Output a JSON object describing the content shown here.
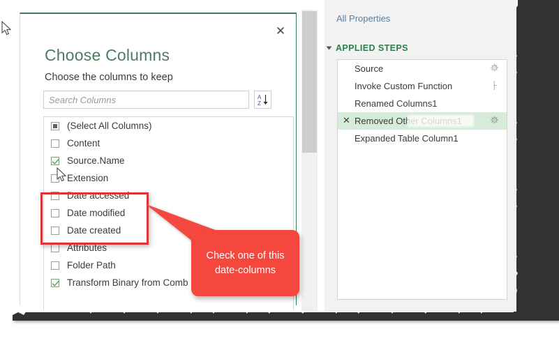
{
  "dialog": {
    "title": "Choose Columns",
    "subtitle": "Choose the columns to keep",
    "close_label": "✕",
    "search": {
      "placeholder": "Search Columns",
      "value": ""
    },
    "sort_button_label": "A-Z sort",
    "columns": [
      {
        "label": "(Select All Columns)",
        "state": "partial"
      },
      {
        "label": "Content",
        "state": "unchecked"
      },
      {
        "label": "Source.Name",
        "state": "checked"
      },
      {
        "label": "Extension",
        "state": "unchecked"
      },
      {
        "label": "Date accessed",
        "state": "unchecked"
      },
      {
        "label": "Date modified",
        "state": "unchecked"
      },
      {
        "label": "Date created",
        "state": "unchecked"
      },
      {
        "label": "Attributes",
        "state": "unchecked"
      },
      {
        "label": "Folder Path",
        "state": "unchecked"
      },
      {
        "label": "Transform Binary from Comb",
        "state": "checked"
      }
    ]
  },
  "annotation": {
    "callout_text": "Check one of this date-columns",
    "callout_color": "#f4483f",
    "highlight_color": "#e03434"
  },
  "right_pane": {
    "all_properties_link": "All Properties",
    "applied_steps_title": "APPLIED STEPS",
    "steps": [
      {
        "label": "Source",
        "selected": false,
        "gear": true,
        "chevron": false,
        "delete_icon": false
      },
      {
        "label": "Invoke Custom Function",
        "selected": false,
        "gear": false,
        "chevron": true,
        "delete_icon": false
      },
      {
        "label": "Renamed Columns1",
        "selected": false,
        "gear": false,
        "chevron": false,
        "delete_icon": false
      },
      {
        "label": "Removed Other Columns1",
        "selected": true,
        "gear": true,
        "chevron": false,
        "delete_icon": true
      },
      {
        "label": "Expanded Table Column1",
        "selected": false,
        "gear": false,
        "chevron": false,
        "delete_icon": false
      }
    ],
    "link_color": "#5d7f9c",
    "header_color": "#2f7d4f",
    "selected_row_color": "#d4ecd8"
  }
}
